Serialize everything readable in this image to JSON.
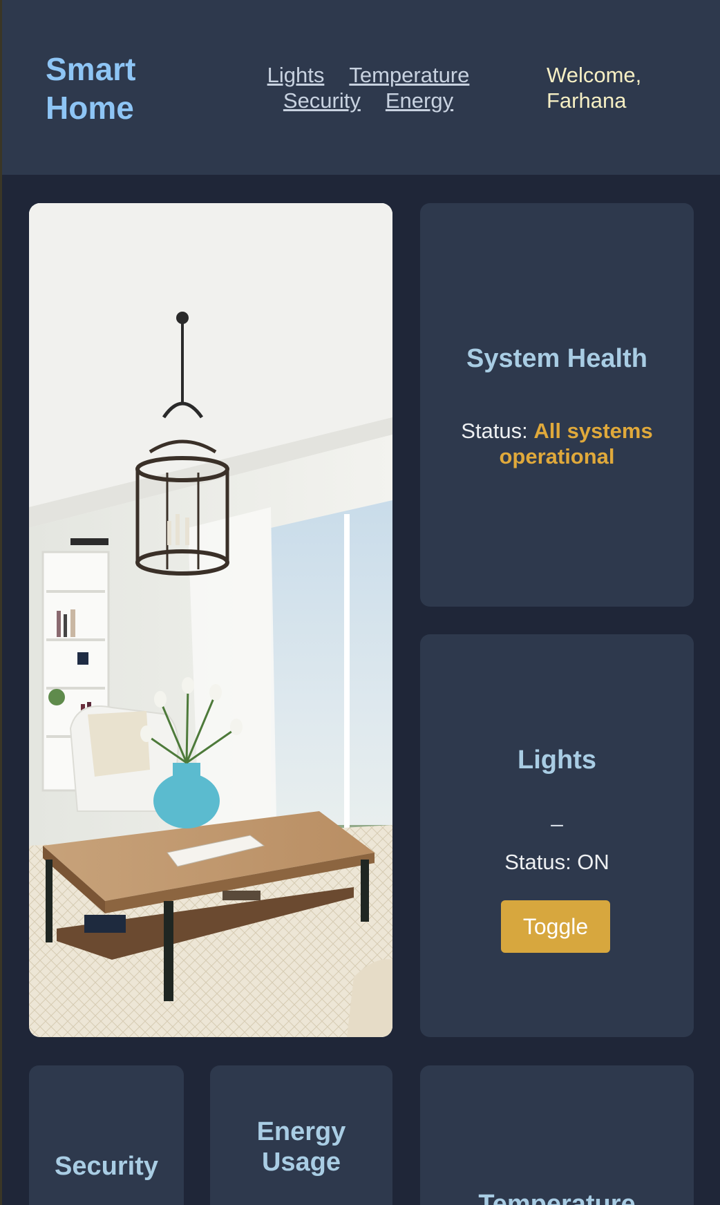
{
  "header": {
    "logo": "Smart Home",
    "nav": [
      "Lights",
      "Temperature",
      "Security",
      "Energy"
    ],
    "welcome": "Welcome, Farhana"
  },
  "hero": {
    "image_subject": "living room with chandelier, coffee table, vase with tulips, armchair, bookshelf and window view"
  },
  "system_health": {
    "title": "System Health",
    "status_label": "Status:",
    "status_value": "All systems operational"
  },
  "lights": {
    "title": "Lights",
    "dash": "–",
    "status": "Status: ON",
    "button": "Toggle"
  },
  "bottom_cards": {
    "security": "Security",
    "energy": "Energy Usage",
    "temperature": "Temperature"
  },
  "colors": {
    "accent_gold": "#d7a73e",
    "logo_blue": "#8ec5f5",
    "card_bg": "#2e394d",
    "page_bg": "#1f2638"
  }
}
